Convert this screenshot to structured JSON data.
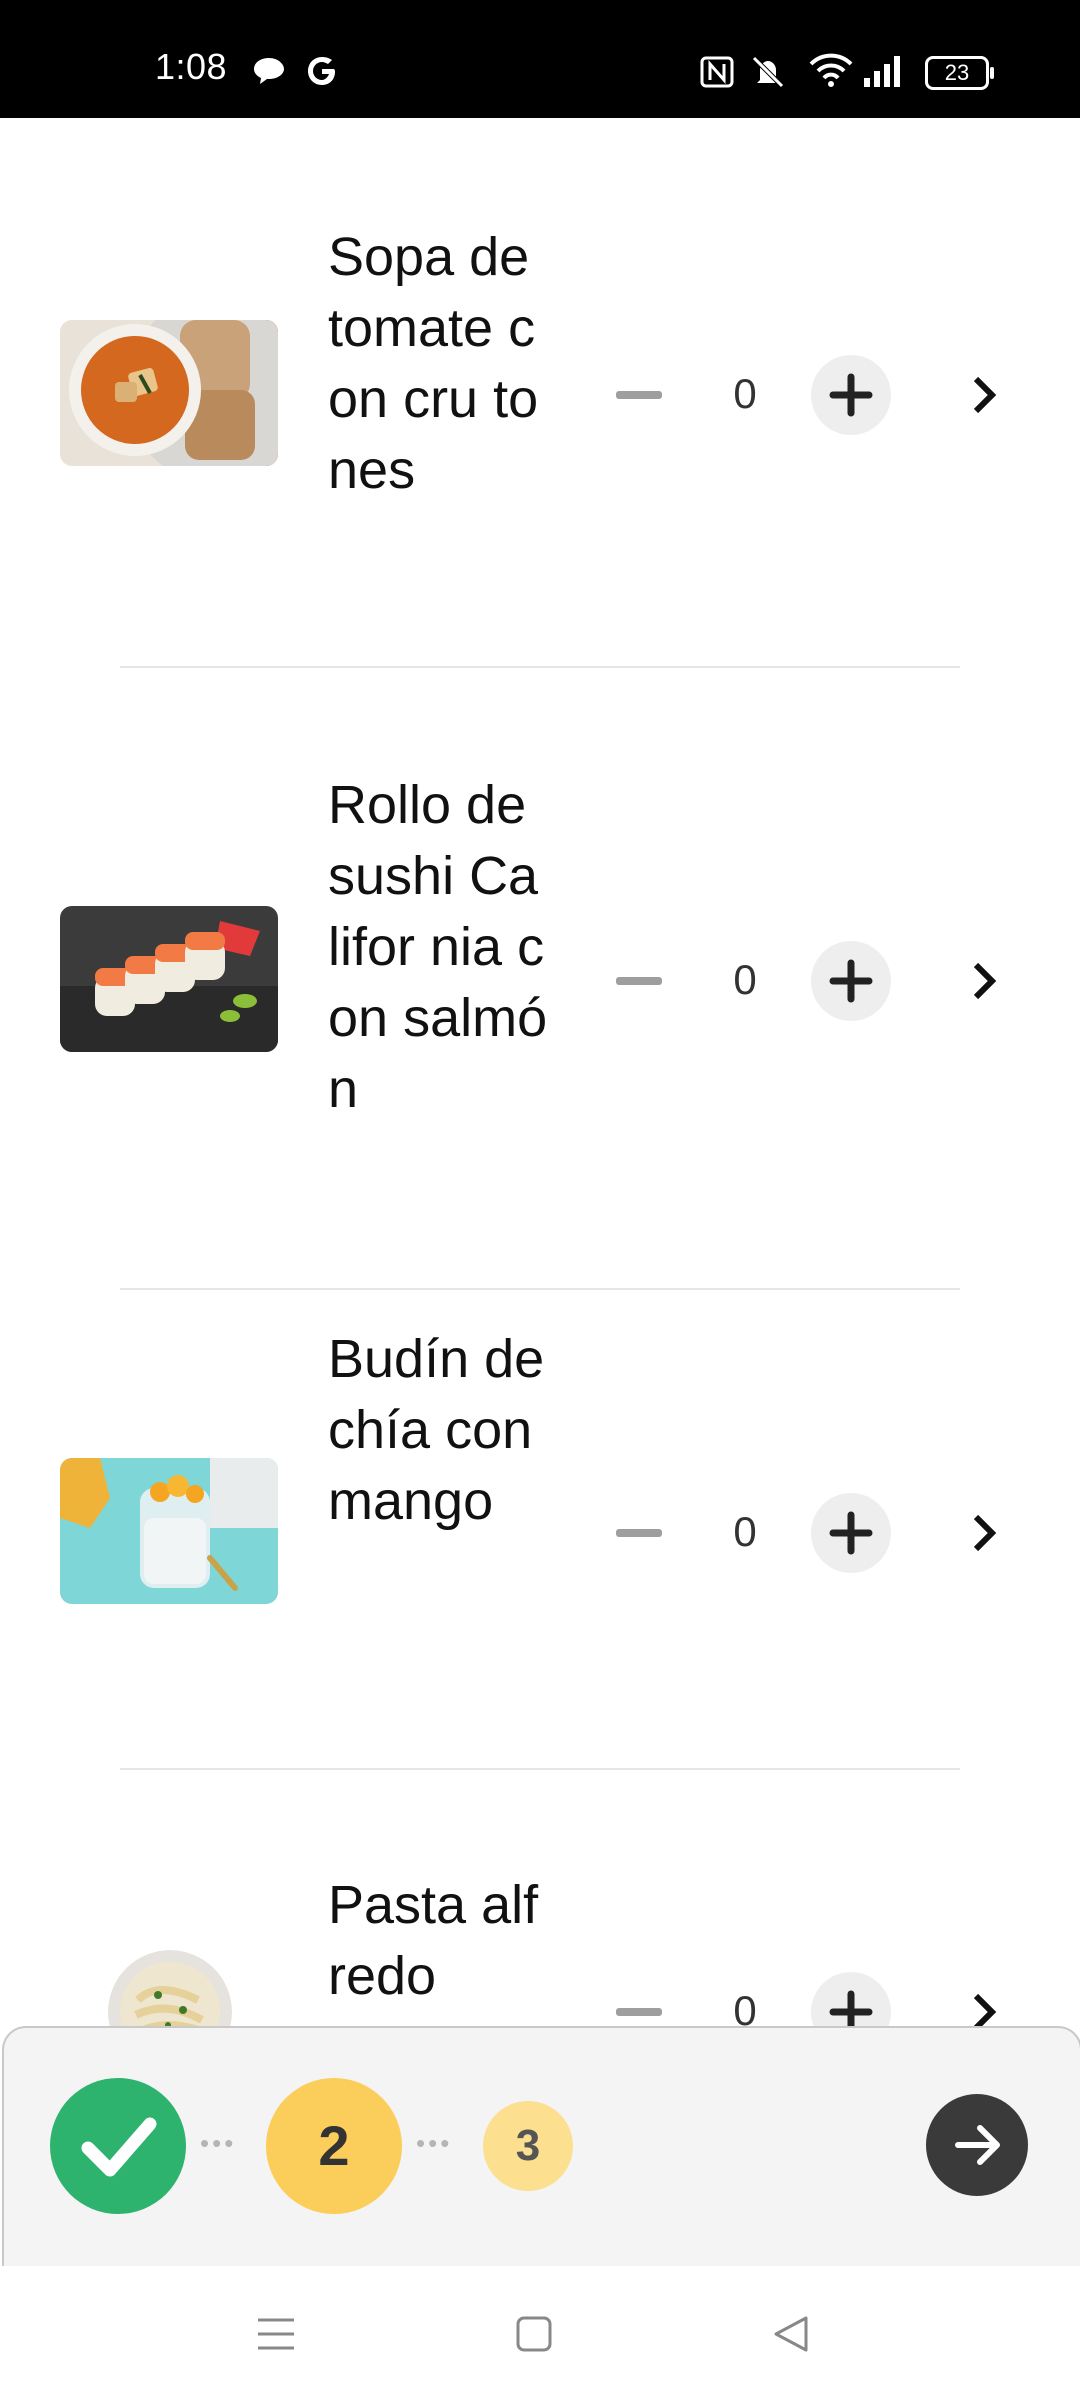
{
  "status_bar": {
    "time": "1:08",
    "battery": "23",
    "icons": [
      "chat-bubble-icon",
      "google-icon",
      "nfc-icon",
      "mute-icon",
      "wifi-icon",
      "signal-icon",
      "battery-icon"
    ]
  },
  "food_list": {
    "items": [
      {
        "name": "Sopa de tomate con cru tones",
        "quantity": "0",
        "image": "tomato-soup-image"
      },
      {
        "name": "Rollo de sushi Califor nia con salmón",
        "quantity": "0",
        "image": "salmon-sushi-image"
      },
      {
        "name": "Budín de chía con mango",
        "quantity": "0",
        "image": "chia-mango-pudding-image"
      },
      {
        "name": "Pasta alfredo",
        "quantity": "0",
        "image": "pasta-alfredo-image"
      }
    ]
  },
  "progress": {
    "steps": [
      {
        "label": "",
        "state": "completed"
      },
      {
        "label": "2",
        "state": "current"
      },
      {
        "label": "3",
        "state": "upcoming"
      }
    ],
    "colors": {
      "completed": "#2db36d",
      "current": "#fbcd5a",
      "upcoming": "#fcdf8f"
    }
  },
  "colors": {
    "background": "#ffffff",
    "status_bar": "#000000",
    "next_button": "#3a3a3a"
  }
}
